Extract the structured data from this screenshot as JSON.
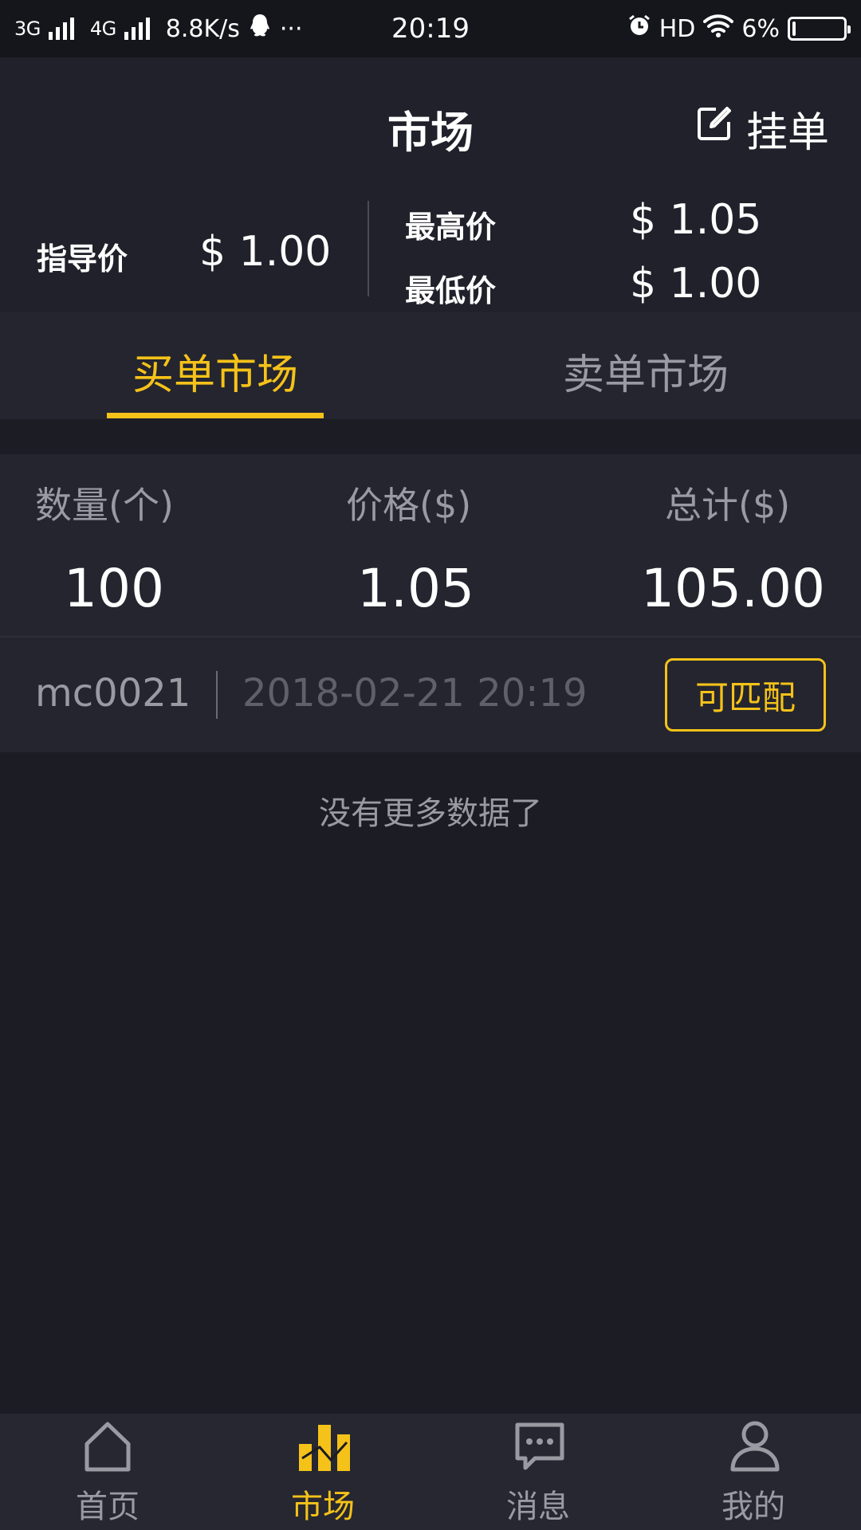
{
  "status_bar": {
    "network_1": "3G",
    "network_2": "4G",
    "speed": "8.8K/s",
    "more": "···",
    "time": "20:19",
    "hd": "HD",
    "battery": "6%",
    "battery_level": 0.06
  },
  "header": {
    "title": "市场",
    "post_order_label": "挂单"
  },
  "price_summary": {
    "guide_label": "指导价",
    "guide_value": "$ 1.00",
    "high_label": "最高价",
    "high_value": "$ 1.05",
    "low_label": "最低价",
    "low_value": "$ 1.00"
  },
  "tabs": [
    {
      "label": "买单市场",
      "active": true
    },
    {
      "label": "卖单市场",
      "active": false
    }
  ],
  "orders": {
    "columns": [
      "数量(个)",
      "价格($)",
      "总计($)"
    ],
    "rows": [
      {
        "quantity": "100",
        "price": "1.05",
        "total": "105.00",
        "user": "mc0021",
        "time": "2018-02-21 20:19",
        "action": "可匹配"
      }
    ],
    "no_more": "没有更多数据了"
  },
  "bottom_nav": [
    {
      "label": "首页",
      "icon": "home-icon",
      "active": false
    },
    {
      "label": "市场",
      "icon": "market-chart-icon",
      "active": true
    },
    {
      "label": "消息",
      "icon": "message-icon",
      "active": false
    },
    {
      "label": "我的",
      "icon": "profile-icon",
      "active": false
    }
  ],
  "colors": {
    "accent": "#f5c21a",
    "background": "#1b1c24",
    "panel": "#24252e",
    "muted_text": "#9a9aa2"
  }
}
